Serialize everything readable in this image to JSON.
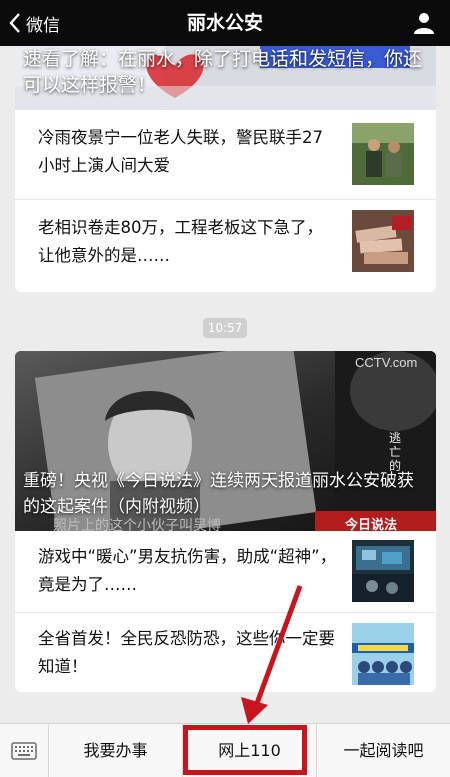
{
  "navbar": {
    "back_label": "微信",
    "title": "丽水公安"
  },
  "card1": {
    "cover_title": "速看了解：在丽水，除了打电话和发短信，你还可以这样报警！",
    "items": [
      {
        "title": "冷雨夜景宁一位老人失联，警民联手27小时上演人间大爱"
      },
      {
        "title": "老相识卷走80万，工程老板这下急了，让他意外的是……"
      }
    ]
  },
  "time_badge": "10:57",
  "card2": {
    "cover_title": "重磅！央视《今日说法》连续两天报道丽水公安破获的这起案件（内附视频）",
    "cover_caption": "照片上的这个小伙子叫吴博",
    "watermark": "CCTV.com",
    "side_text": "逃亡的",
    "program_label": "今日说法",
    "items": [
      {
        "title": "游戏中“暖心”男友抗伤害，助成“超神”，竟是为了……"
      },
      {
        "title": "全省首发！全民反恐防恐，这些你一定要知道！"
      }
    ]
  },
  "bottom_menu": {
    "items": [
      {
        "label": "我要办事"
      },
      {
        "label": "网上110"
      },
      {
        "label": "一起阅读吧"
      }
    ]
  },
  "colors": {
    "navbar_bg": "#0b0b0b",
    "highlight_red": "#c8141e",
    "page_bg": "#ececec"
  }
}
